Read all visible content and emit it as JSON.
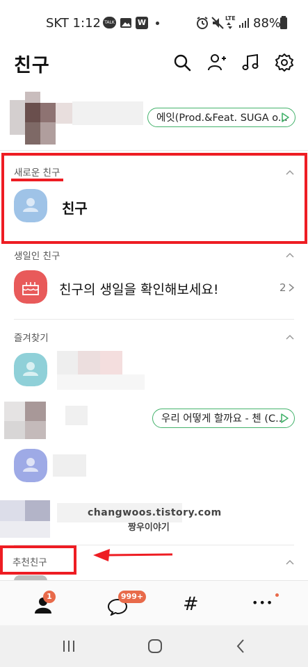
{
  "status_bar": {
    "carrier_time": "SKT 1:12",
    "w_badge": "W",
    "talk_icon": "TALK",
    "battery": "88%",
    "lte": "LTE"
  },
  "header": {
    "title": "친구",
    "icons": [
      "search-icon",
      "add-friend-icon",
      "music-icon",
      "settings-icon"
    ]
  },
  "my_profile": {
    "music_pill": "에잇(Prod.&Feat. SUGA o..."
  },
  "sections": {
    "new_friends": {
      "label": "새로운 친구",
      "item_name": "친구"
    },
    "birthday": {
      "label": "생일인 친구",
      "item_text": "친구의 생일을 확인해보세요!",
      "count": "2"
    },
    "favorites": {
      "label": "즐겨찾기",
      "music_pill": "우리 어떻게 할까요 - 첸 (C..."
    },
    "recommended": {
      "label": "추천친구"
    }
  },
  "watermark": {
    "line1": "changwoos.tistory.com",
    "line2": "짱우이야기"
  },
  "tab_bar": {
    "friends_badge": "1",
    "chats_badge": "999+",
    "hash": "#",
    "more": "•••"
  },
  "colors": {
    "highlight": "#ee1d23",
    "music_pill_border": "#43b26b",
    "badge": "#e86a4a",
    "birthday_icon": "#e85a5a"
  }
}
